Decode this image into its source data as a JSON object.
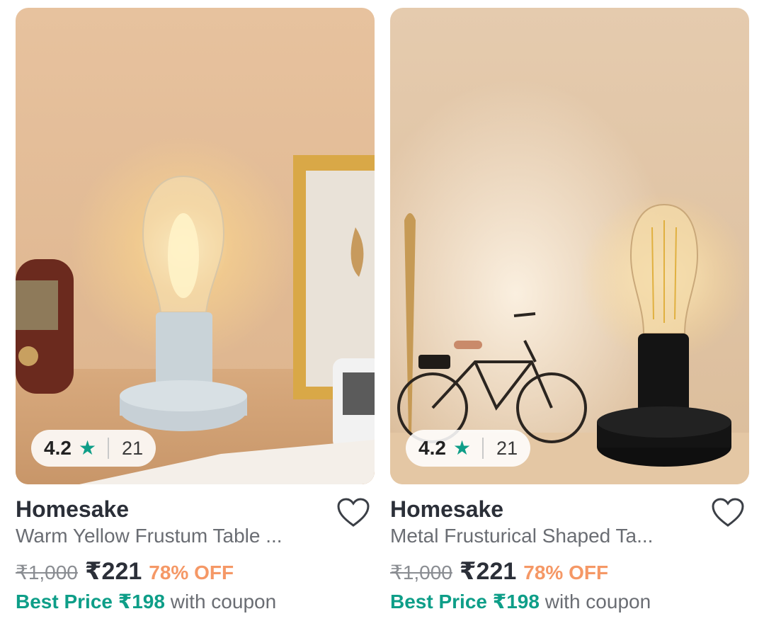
{
  "products": [
    {
      "brand": "Homesake",
      "title": "Warm Yellow Frustum Table ...",
      "mrp": "₹1,000",
      "price": "₹221",
      "discount": "78% OFF",
      "best_price_label": "Best Price ₹198",
      "best_price_suffix": "with coupon",
      "rating": "4.2",
      "rating_count": "21",
      "image": "white base table lamp with warm filament bulb on wooden desk"
    },
    {
      "brand": "Homesake",
      "title": "Metal Frusturical Shaped Ta...",
      "mrp": "₹1,000",
      "price": "₹221",
      "discount": "78% OFF",
      "best_price_label": "Best Price ₹198",
      "best_price_suffix": "with coupon",
      "rating": "4.2",
      "rating_count": "21",
      "image": "black base table lamp with vintage filament bulb beside a model bicycle"
    }
  ],
  "icons": {
    "star": "star-icon",
    "wishlist": "heart-outline-icon"
  },
  "colors": {
    "accent_green": "#0e9e88",
    "discount_orange": "#f59866",
    "text_dark": "#2b2f38",
    "text_muted": "#6a6d73"
  }
}
